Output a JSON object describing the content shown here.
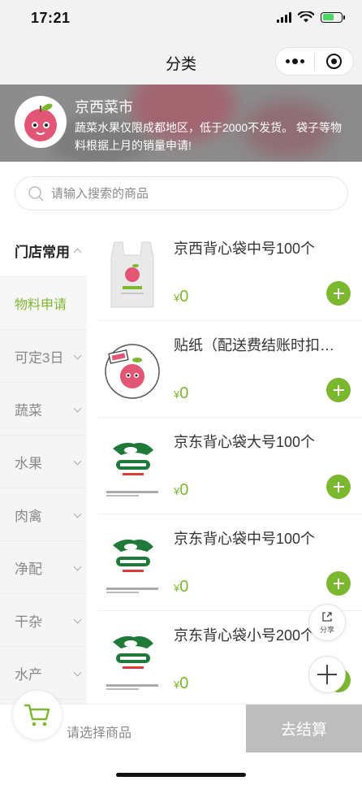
{
  "status_bar": {
    "time": "17:21"
  },
  "nav": {
    "title": "分类"
  },
  "banner": {
    "shop_name": "京西菜市",
    "notice": "蔬菜水果仅限成都地区，低于2000不发货。 袋子等物料根据上月的销量申请!"
  },
  "search": {
    "placeholder": "请输入搜索的商品"
  },
  "sidebar": {
    "items": [
      {
        "label": "门店常用",
        "state": "group-open"
      },
      {
        "label": "物料申请",
        "state": "active"
      },
      {
        "label": "可定3日",
        "state": ""
      },
      {
        "label": "蔬菜",
        "state": ""
      },
      {
        "label": "水果",
        "state": ""
      },
      {
        "label": "肉禽",
        "state": ""
      },
      {
        "label": "净配",
        "state": ""
      },
      {
        "label": "干杂",
        "state": ""
      },
      {
        "label": "水产",
        "state": ""
      }
    ]
  },
  "products": [
    {
      "name": "京西背心袋中号100个",
      "currency": "¥",
      "price": "0",
      "image": "bag-icon"
    },
    {
      "name": "贴纸（配送费结账时扣…",
      "currency": "¥",
      "price": "0",
      "image": "sticker-icon"
    },
    {
      "name": "京东背心袋大号100个",
      "currency": "¥",
      "price": "0",
      "image": "jd-bag-icon"
    },
    {
      "name": "京东背心袋中号100个",
      "currency": "¥",
      "price": "0",
      "image": "jd-bag-icon"
    },
    {
      "name": "京东背心袋小号200个",
      "currency": "¥",
      "price": "0",
      "image": "jd-bag-icon"
    }
  ],
  "floating": {
    "share_label": "分享"
  },
  "cart": {
    "hint": "请选择商品",
    "checkout_label": "去结算"
  },
  "colors": {
    "accent": "#7cb82f",
    "checkout_disabled": "#bdbdbd"
  }
}
